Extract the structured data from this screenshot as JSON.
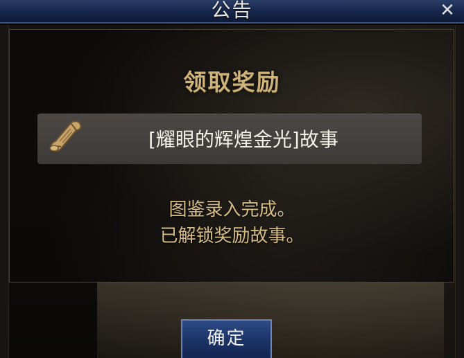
{
  "dialog": {
    "title": "公告",
    "close_label": "✕",
    "heading": "领取奖励",
    "reward": {
      "icon": "scroll-icon",
      "name": "[耀眼的辉煌金光]故事"
    },
    "message_line1": "图鉴录入完成。",
    "message_line2": "已解锁奖励故事。",
    "confirm_label": "确定"
  },
  "colors": {
    "title_bar": "#16264a",
    "heading": "#cdb27a",
    "message": "#d6bd85",
    "button": "#1b3266"
  }
}
